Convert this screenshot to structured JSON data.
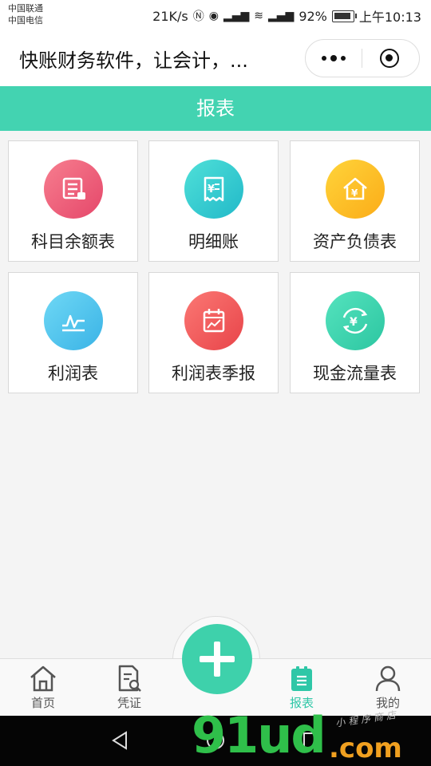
{
  "status": {
    "carrier1": "中国联通",
    "carrier2": "中国电信",
    "speed": "21K/s",
    "battery": "92%",
    "time": "上午10:13"
  },
  "titlebar": {
    "title": "快账财务软件，让会计，..."
  },
  "header": {
    "title": "报表"
  },
  "reports": [
    {
      "label": "科目余额表",
      "icon": "ledger-icon"
    },
    {
      "label": "明细账",
      "icon": "receipt-icon"
    },
    {
      "label": "资产负债表",
      "icon": "house-icon"
    },
    {
      "label": "利润表",
      "icon": "line-chart-icon"
    },
    {
      "label": "利润表季报",
      "icon": "calendar-chart-icon"
    },
    {
      "label": "现金流量表",
      "icon": "yuan-cycle-icon"
    }
  ],
  "tabbar": {
    "home": "首页",
    "voucher": "凭证",
    "reports": "报表",
    "mine": "我的"
  },
  "watermark": {
    "main": "91ud",
    "sub": ".com",
    "tag": "小程序商店"
  },
  "colors": {
    "accent": "#43d3b1",
    "active_tab": "#2fc7a7"
  }
}
